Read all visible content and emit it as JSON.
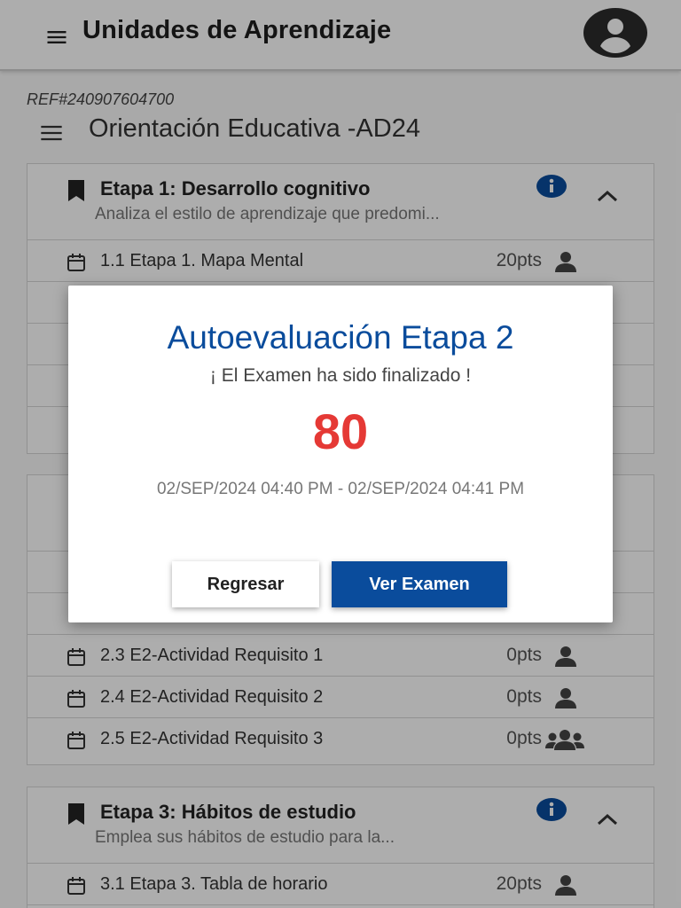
{
  "appbar": {
    "title": "Unidades de Aprendizaje",
    "menu_icon": "menu-icon",
    "avatar_icon": "account-circle-icon"
  },
  "ref": "REF#240907604700",
  "course": {
    "title": "Orientación Educativa -AD24"
  },
  "stage1": {
    "title": "Etapa 1: Desarrollo cognitivo",
    "description": "Analiza el estilo de aprendizaje que predomi...",
    "items": [
      {
        "label": "1.1 Etapa 1. Mapa Mental",
        "points": "20pts"
      }
    ]
  },
  "stage2": {
    "items": [
      {
        "label": "2.3 E2-Actividad Requisito 1",
        "points": "0pts"
      },
      {
        "label": "2.4 E2-Actividad Requisito 2",
        "points": "0pts"
      },
      {
        "label": "2.5 E2-Actividad Requisito 3",
        "points": "0pts"
      }
    ]
  },
  "stage3": {
    "title": "Etapa 3: Hábitos de estudio",
    "description": "Emplea sus hábitos de estudio para la...",
    "items": [
      {
        "label": "3.1 Etapa 3. Tabla de horario",
        "points": "20pts"
      }
    ]
  },
  "dialog": {
    "title": "Autoevaluación Etapa 2",
    "subtitle": "¡ El Examen ha sido finalizado !",
    "score": "80",
    "dates": "02/SEP/2024 04:40 PM - 02/SEP/2024 04:41 PM",
    "back_label": "Regresar",
    "view_label": "Ver Examen"
  },
  "colors": {
    "primary": "#0a4c9c",
    "score": "#e53935"
  }
}
